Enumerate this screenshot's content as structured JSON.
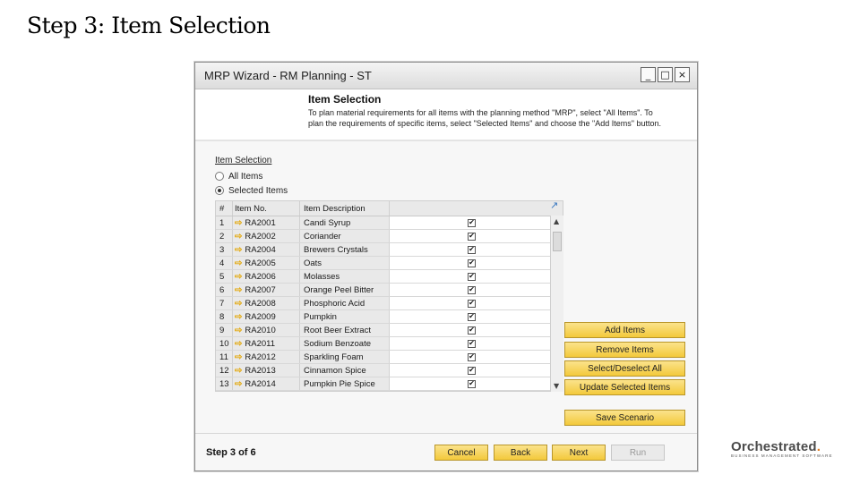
{
  "slide": {
    "title": "Step 3: Item Selection"
  },
  "window": {
    "title": "MRP Wizard - RM Planning - ST",
    "controls": {
      "minimize": "_",
      "maximize": "□",
      "close": "×"
    }
  },
  "header": {
    "title": "Item Selection",
    "description": "To plan material requirements for all items with the planning method \"MRP\", select \"All Items\". To plan the requirements of specific items, select \"Selected Items\" and choose the \"Add Items\" button."
  },
  "item_selection": {
    "label": "Item Selection",
    "options": [
      {
        "label": "All Items",
        "checked": false
      },
      {
        "label": "Selected Items",
        "checked": true
      }
    ]
  },
  "grid": {
    "columns": [
      "#",
      "Item No.",
      "Item Description",
      ""
    ],
    "rows": [
      {
        "num": "1",
        "item_no": "RA2001",
        "desc": "Candi Syrup",
        "checked": true
      },
      {
        "num": "2",
        "item_no": "RA2002",
        "desc": "Coriander",
        "checked": true
      },
      {
        "num": "3",
        "item_no": "RA2004",
        "desc": "Brewers Crystals",
        "checked": true
      },
      {
        "num": "4",
        "item_no": "RA2005",
        "desc": "Oats",
        "checked": true
      },
      {
        "num": "5",
        "item_no": "RA2006",
        "desc": "Molasses",
        "checked": true
      },
      {
        "num": "6",
        "item_no": "RA2007",
        "desc": "Orange Peel Bitter",
        "checked": true
      },
      {
        "num": "7",
        "item_no": "RA2008",
        "desc": "Phosphoric Acid",
        "checked": true
      },
      {
        "num": "8",
        "item_no": "RA2009",
        "desc": "Pumpkin",
        "checked": true
      },
      {
        "num": "9",
        "item_no": "RA2010",
        "desc": "Root Beer Extract",
        "checked": true
      },
      {
        "num": "10",
        "item_no": "RA2011",
        "desc": "Sodium Benzoate",
        "checked": true
      },
      {
        "num": "11",
        "item_no": "RA2012",
        "desc": "Sparkling Foam",
        "checked": true
      },
      {
        "num": "12",
        "item_no": "RA2013",
        "desc": "Cinnamon Spice",
        "checked": true
      },
      {
        "num": "13",
        "item_no": "RA2014",
        "desc": "Pumpkin Pie Spice",
        "checked": true
      }
    ]
  },
  "side_buttons": {
    "add_items": "Add Items",
    "remove_items": "Remove Items",
    "select_deselect_all": "Select/Deselect All",
    "update_selected_items": "Update Selected Items",
    "save_scenario": "Save Scenario"
  },
  "footer": {
    "step": "Step 3 of 6",
    "cancel": "Cancel",
    "back": "Back",
    "next": "Next",
    "run": "Run"
  },
  "logo": {
    "name_main": "Orchestrated",
    "name_dot": ".",
    "tagline": "BUSINESS MANAGEMENT SOFTWARE"
  },
  "colors": {
    "button_yellow": "#f3c93b",
    "arrow_orange": "#e3a500",
    "logo_orange": "#e27b1e"
  },
  "icons": {
    "link_arrow": "link-arrow-icon",
    "expand": "expand-icon"
  }
}
